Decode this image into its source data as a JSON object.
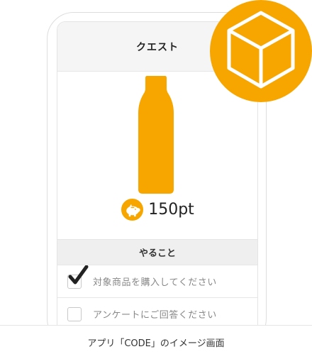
{
  "header": {
    "title": "クエスト"
  },
  "reward": {
    "points": "150pt"
  },
  "section": {
    "title": "やること"
  },
  "tasks": [
    {
      "label": "対象商品を購入してください",
      "checked": true
    },
    {
      "label": "アンケートにご回答ください",
      "checked": false
    }
  ],
  "caption": "アプリ「CODE」のイメージ画面",
  "colors": {
    "accent": "#F7A600",
    "header_bg": "#F5F5F5",
    "section_bg": "#EFEFEF"
  },
  "icons": {
    "product": "bottle-icon",
    "points": "piggy-bank-coin-icon",
    "badge": "cube-icon",
    "check": "checkmark-icon"
  }
}
